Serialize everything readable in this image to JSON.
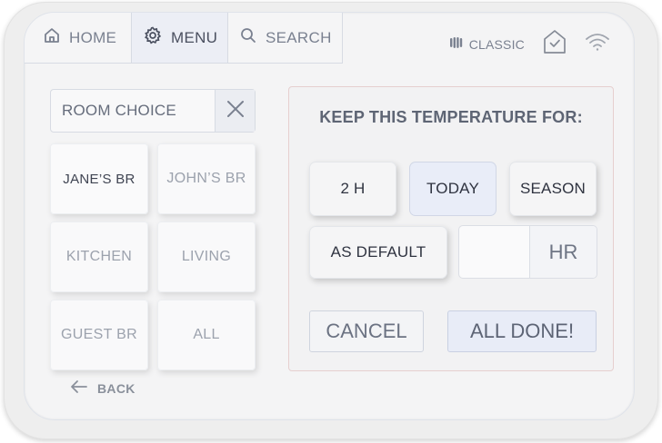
{
  "nav": {
    "items": [
      {
        "label": "HOME",
        "icon": "home-icon"
      },
      {
        "label": "MENU",
        "icon": "gear-icon",
        "active": true
      },
      {
        "label": "SEARCH",
        "icon": "search-icon"
      }
    ]
  },
  "status": {
    "mode_label": "CLASSIC",
    "mode_icon": "heater-icon",
    "home_icon": "home-check-icon",
    "wifi_icon": "wifi-icon"
  },
  "rooms": {
    "title": "ROOM CHOICE",
    "clear_icon": "close-icon",
    "items": [
      {
        "label": "JANE’S BR",
        "selected": true
      },
      {
        "label": "JOHN’S BR"
      },
      {
        "label": "KITCHEN"
      },
      {
        "label": "LIVING"
      },
      {
        "label": "GUEST BR"
      },
      {
        "label": "ALL"
      }
    ],
    "back_label": "BACK"
  },
  "schedule": {
    "title": "KEEP THIS TEMPERATURE FOR:",
    "options": [
      {
        "label": "2 H"
      },
      {
        "label": "TODAY",
        "selected": true
      },
      {
        "label": "SEASON"
      },
      {
        "label": "AS DEFAULT"
      }
    ],
    "hours_value": "",
    "hours_unit": "HR",
    "cancel_label": "CANCEL",
    "done_label": "ALL DONE!"
  },
  "colors": {
    "accent": "#e9edf8",
    "background": "#f4f4f5",
    "text": "#6b7280"
  }
}
